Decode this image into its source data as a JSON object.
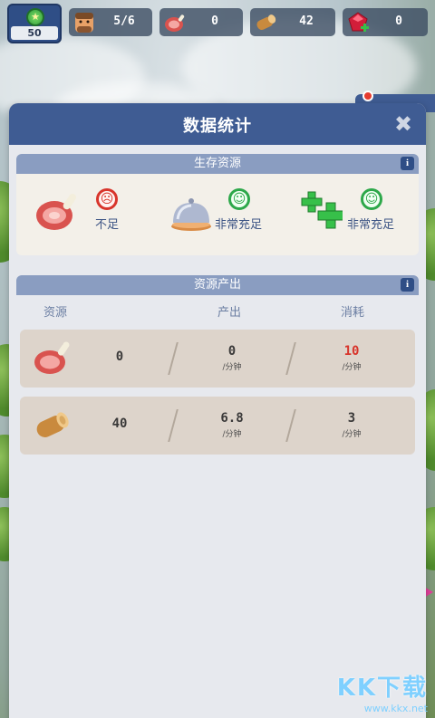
{
  "hud": {
    "level": "50",
    "population": "5/6",
    "meat": "0",
    "wood": "42",
    "gem": "0"
  },
  "modal": {
    "title": "数据统计",
    "close": "✖"
  },
  "survival": {
    "header": "生存资源",
    "info": "i",
    "items": [
      {
        "icon": "meat-icon",
        "status": "不足",
        "mood": "sad"
      },
      {
        "icon": "food-cloche-icon",
        "status": "非常充足",
        "mood": "happy"
      },
      {
        "icon": "health-cross-icon",
        "status": "非常充足",
        "mood": "happy"
      }
    ]
  },
  "production": {
    "header": "资源产出",
    "info": "i",
    "columns": [
      "资源",
      "产出",
      "消耗"
    ],
    "unit": "/分钟",
    "rows": [
      {
        "icon": "meat-icon",
        "amount": "0",
        "output": "0",
        "consume": "10",
        "consume_color": "#d8352c"
      },
      {
        "icon": "wood-log-icon",
        "amount": "40",
        "output": "6.8",
        "consume": "3",
        "consume_color": "#3b3a3a"
      }
    ]
  },
  "watermark": {
    "brand": "KK下载",
    "url": "www.kkx.net"
  }
}
